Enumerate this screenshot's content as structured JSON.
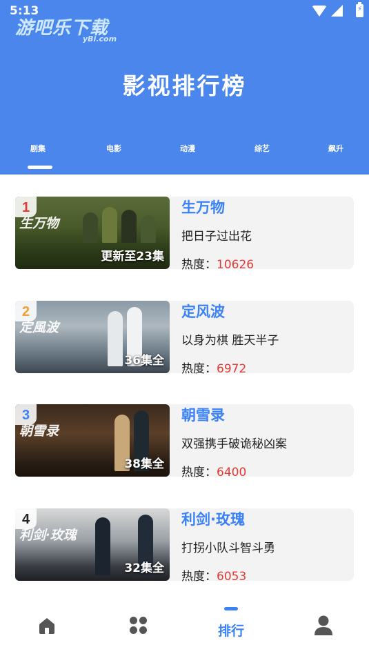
{
  "status_bar": {
    "time": "5:13",
    "watermark": "游吧乐下载",
    "watermark_sub": "yBi.com",
    "wifi_icon": "wifi-icon",
    "signal_icon": "cell-signal-icon",
    "battery_icon": "battery-charging-icon"
  },
  "header": {
    "title": "影视排行榜",
    "accent_color": "#4a86ec"
  },
  "tabs": [
    {
      "label": "剧集",
      "active": true
    },
    {
      "label": "电影",
      "active": false
    },
    {
      "label": "动漫",
      "active": false
    },
    {
      "label": "综艺",
      "active": false
    },
    {
      "label": "飙升",
      "active": false
    }
  ],
  "rank_list": [
    {
      "rank": "1",
      "rank_color": "#e53935",
      "title": "生万物",
      "desc": "把日子过出花",
      "heat_label": "热度：",
      "heat": "10626",
      "episodes": "更新至23集",
      "thumb_text": "生万物"
    },
    {
      "rank": "2",
      "rank_color": "#f0a030",
      "title": "定风波",
      "desc": "以身为棋 胜天半子",
      "heat_label": "热度：",
      "heat": "6972",
      "episodes": "36集全",
      "thumb_text": "定風波"
    },
    {
      "rank": "3",
      "rank_color": "#3b82f6",
      "title": "朝雪录",
      "desc": "双强携手破诡秘凶案",
      "heat_label": "热度：",
      "heat": "6400",
      "episodes": "38集全",
      "thumb_text": "朝雪录"
    },
    {
      "rank": "4",
      "rank_color": "#222222",
      "title": "利剑·玫瑰",
      "desc": "打拐小队斗智斗勇",
      "heat_label": "热度：",
      "heat": "6053",
      "episodes": "32集全",
      "thumb_text": "利剑·玫瑰"
    }
  ],
  "bottom_nav": [
    {
      "icon": "home-icon",
      "label": ""
    },
    {
      "icon": "apps-grid-icon",
      "label": ""
    },
    {
      "icon": "rank-bar-icon",
      "label": "排行",
      "active": true
    },
    {
      "icon": "user-profile-icon",
      "label": ""
    }
  ]
}
